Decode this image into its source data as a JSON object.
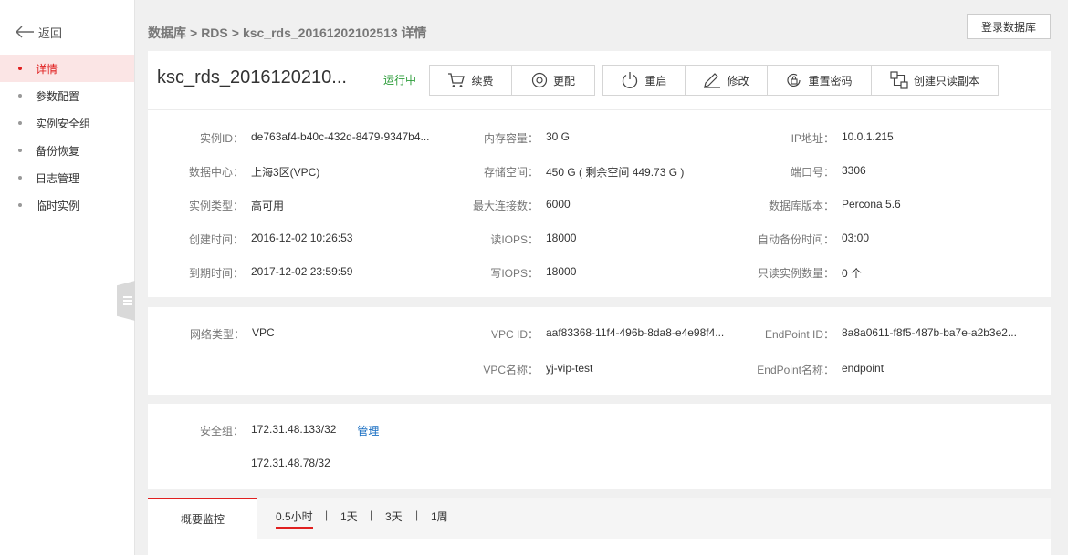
{
  "sidebar": {
    "back_label": "返回",
    "items": [
      {
        "label": "详情",
        "active": true
      },
      {
        "label": "参数配置"
      },
      {
        "label": "实例安全组"
      },
      {
        "label": "备份恢复"
      },
      {
        "label": "日志管理"
      },
      {
        "label": "临时实例"
      }
    ]
  },
  "header": {
    "breadcrumb": [
      "数据库",
      ">",
      "RDS",
      ">",
      "ksc_rds_20161202102513 详情"
    ],
    "login_button": "登录数据库"
  },
  "instance": {
    "title": "ksc_rds_2016120210...",
    "status": "运行中",
    "actions": {
      "renew": "续费",
      "change": "更配",
      "restart": "重启",
      "modify": "修改",
      "reset_password": "重置密码",
      "create_replica": "创建只读副本"
    }
  },
  "details": {
    "col1": [
      {
        "k": "实例ID：",
        "v": "de763af4-b40c-432d-8479-9347b4..."
      },
      {
        "k": "数据中心：",
        "v": "上海3区(VPC)"
      },
      {
        "k": "实例类型：",
        "v": "高可用"
      },
      {
        "k": "创建时间：",
        "v": "2016-12-02 10:26:53"
      },
      {
        "k": "到期时间：",
        "v": "2017-12-02 23:59:59"
      }
    ],
    "col2": [
      {
        "k": "内存容量：",
        "v": "30 G"
      },
      {
        "k": "存储空间：",
        "v": "450 G ( 剩余空间 449.73 G )"
      },
      {
        "k": "最大连接数：",
        "v": "6000"
      },
      {
        "k": "读IOPS：",
        "v": "18000"
      },
      {
        "k": "写IOPS：",
        "v": "18000"
      }
    ],
    "col3": [
      {
        "k": "IP地址：",
        "v": "10.0.1.215"
      },
      {
        "k": "端口号：",
        "v": "3306"
      },
      {
        "k": "数据库版本：",
        "v": "Percona 5.6"
      },
      {
        "k": "自动备份时间：",
        "v": "03:00"
      },
      {
        "k": "只读实例数量：",
        "v": "0 个"
      }
    ]
  },
  "network": {
    "type_k": "网络类型：",
    "type_v": "VPC",
    "vpc_id_k": "VPC ID：",
    "vpc_id_v": "aaf83368-11f4-496b-8da8-e4e98f4...",
    "vpc_name_k": "VPC名称：",
    "vpc_name_v": "yj-vip-test",
    "endpoint_id_k": "EndPoint ID：",
    "endpoint_id_v": "8a8a0611-f8f5-487b-ba7e-a2b3e2...",
    "endpoint_name_k": "EndPoint名称：",
    "endpoint_name_v": "endpoint"
  },
  "security": {
    "label": "安全组：",
    "groups": [
      "172.31.48.133/32",
      "172.31.48.78/32"
    ],
    "manage": "管理"
  },
  "monitor": {
    "tab": "概要监控",
    "ranges": [
      "0.5小时",
      "1天",
      "3天",
      "1周"
    ],
    "separator": "|"
  }
}
